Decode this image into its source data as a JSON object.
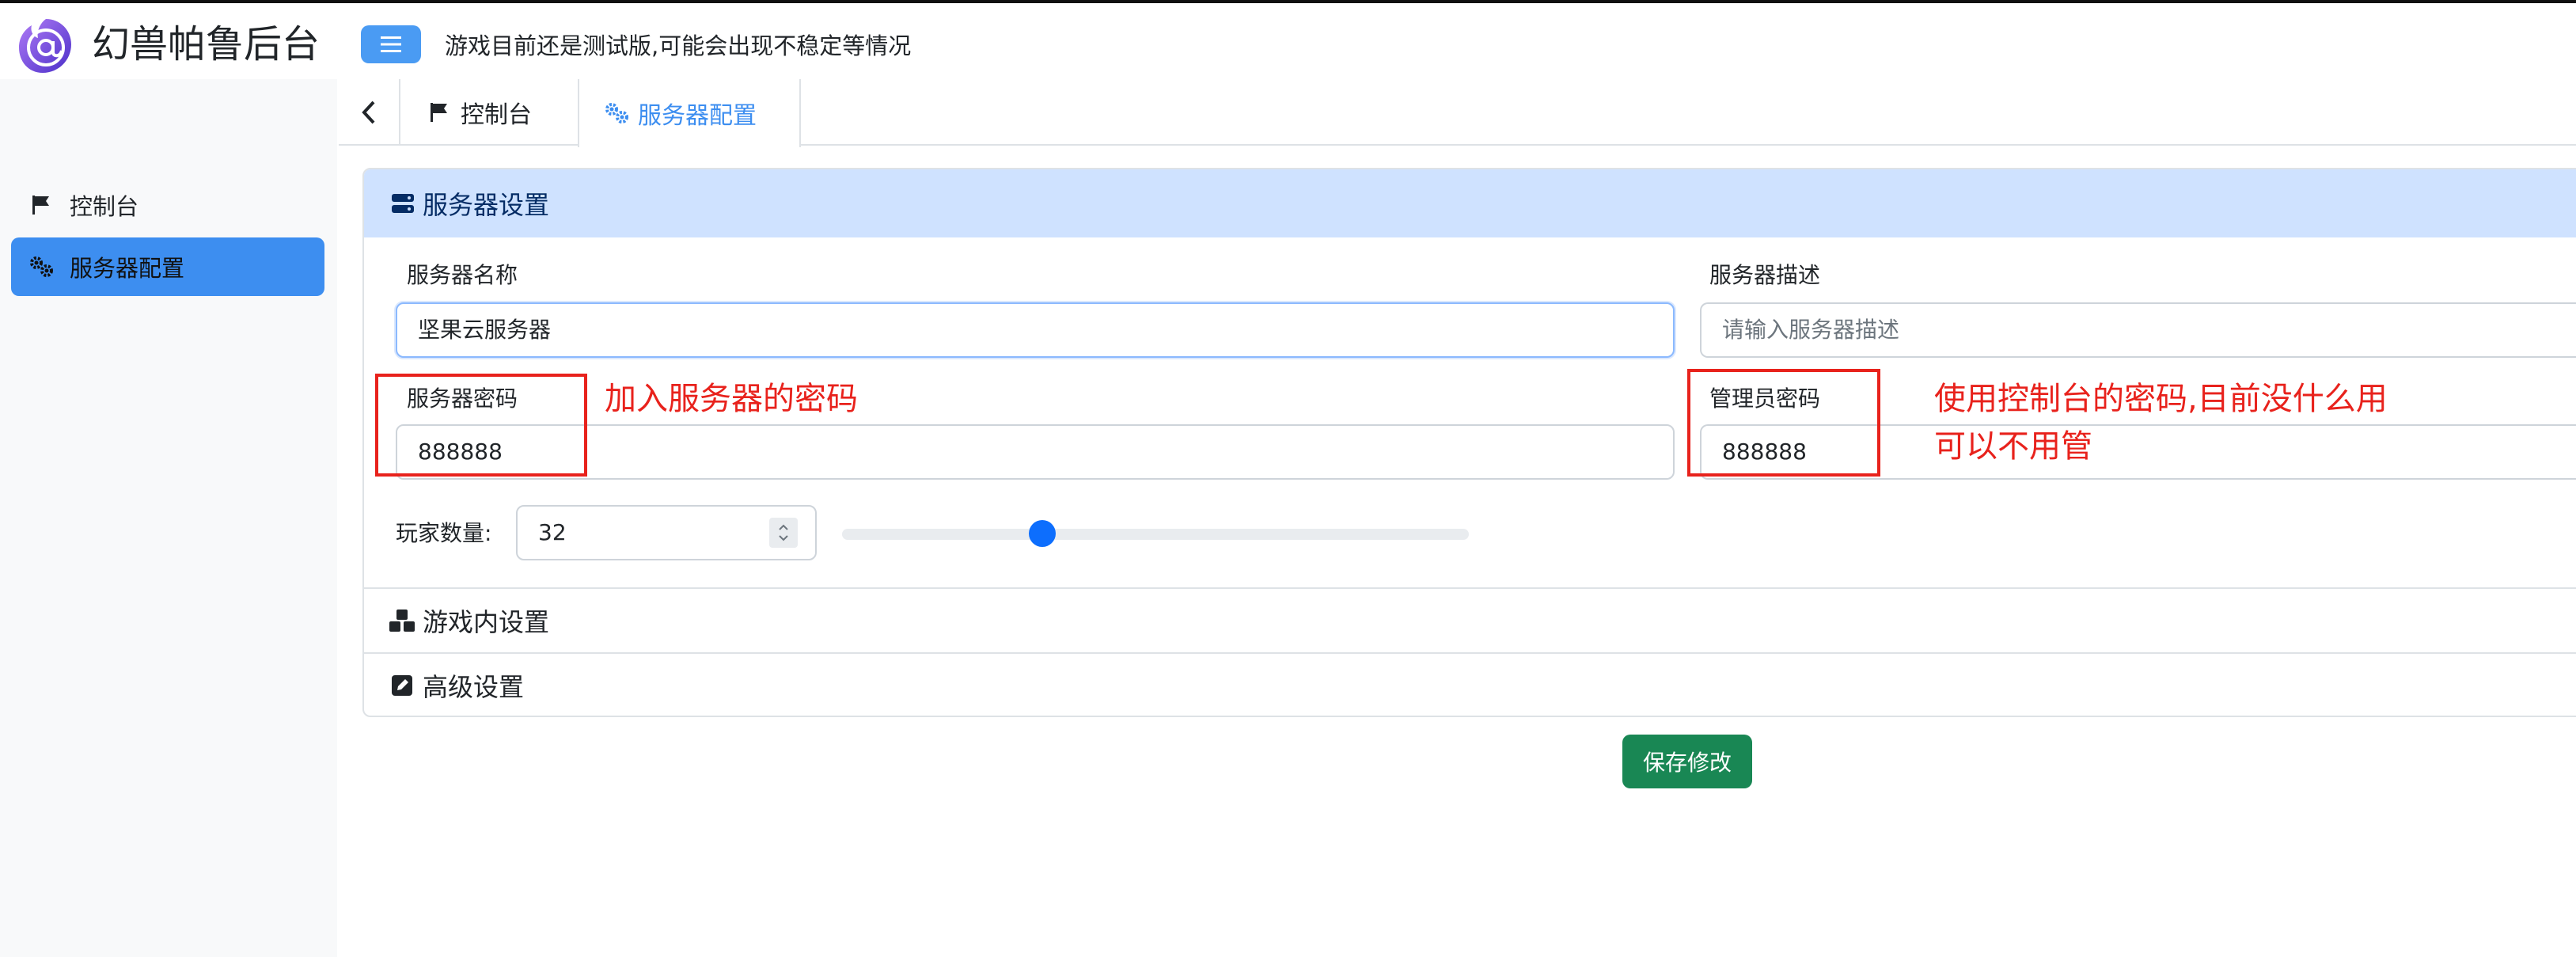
{
  "app": {
    "title": "幻兽帕鲁后台",
    "notice": "游戏目前还是测试版,可能会出现不稳定等情况",
    "menu_icon": "hamburger-icon",
    "colors": {
      "primary": "#3d8ef0",
      "save": "#198754",
      "annotation": "#e8221c",
      "panel_header": "#cfe2ff"
    }
  },
  "sidebar": {
    "items": [
      {
        "label": "控制台",
        "icon": "flag-icon",
        "active": false
      },
      {
        "label": "服务器配置",
        "icon": "gears-icon",
        "active": true
      }
    ]
  },
  "tabs": [
    {
      "label": "控制台",
      "icon": "flag-icon",
      "active": false
    },
    {
      "label": "服务器配置",
      "icon": "gears-icon",
      "active": true
    }
  ],
  "panel": {
    "title": "服务器设置",
    "fields": {
      "server_name": {
        "label": "服务器名称",
        "value": "坚果云服务器"
      },
      "server_desc": {
        "label": "服务器描述",
        "placeholder": "请输入服务器描述"
      },
      "server_password": {
        "label": "服务器密码",
        "value": "888888"
      },
      "admin_password": {
        "label": "管理员密码",
        "value": "888888"
      },
      "players": {
        "label": "玩家数量:",
        "value": "32",
        "slider_fraction": 0.32
      }
    },
    "sections": [
      {
        "label": "游戏内设置",
        "icon": "cubes-icon"
      },
      {
        "label": "高级设置",
        "icon": "edit-icon"
      }
    ]
  },
  "actions": {
    "save_label": "保存修改"
  },
  "annotations": {
    "server_password_note": "加入服务器的密码",
    "admin_password_note_line1": "使用控制台的密码,目前没什么用",
    "admin_password_note_line2": "可以不用管"
  }
}
